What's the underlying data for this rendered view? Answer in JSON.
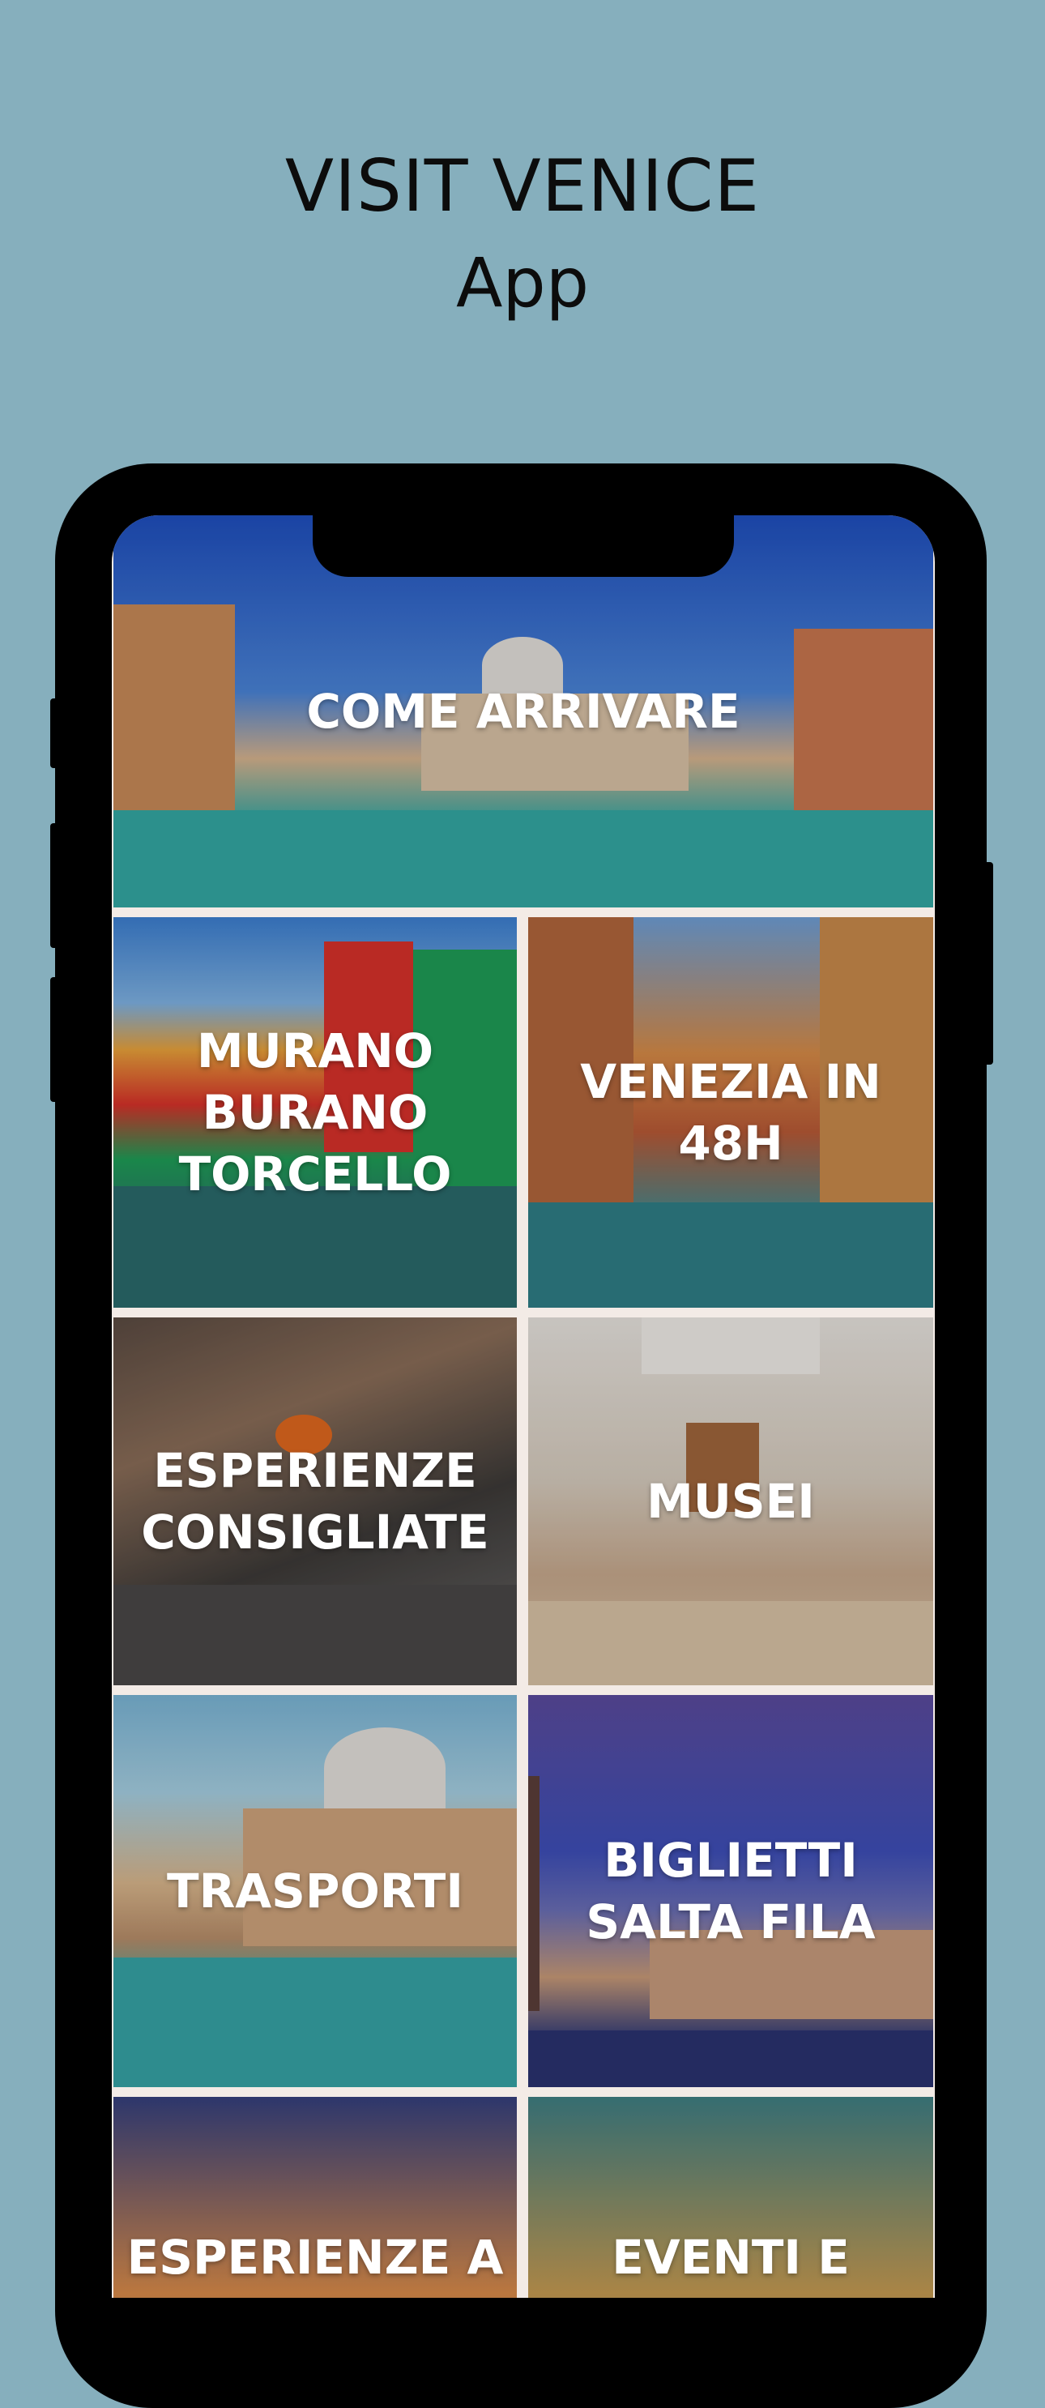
{
  "headline": {
    "line1": "VISIT VENICE",
    "line2": "App"
  },
  "tiles": [
    {
      "id": "come-arrivare",
      "label": "COME ARRIVARE"
    },
    {
      "id": "murano",
      "label": "MURANO\nBURANO\nTORCELLO"
    },
    {
      "id": "venezia-48h",
      "label": "VENEZIA IN\n48H"
    },
    {
      "id": "esperienze",
      "label": "ESPERIENZE\nCONSIGLIATE"
    },
    {
      "id": "musei",
      "label": "MUSEI"
    },
    {
      "id": "trasporti",
      "label": "TRASPORTI"
    },
    {
      "id": "biglietti",
      "label": "BIGLIETTI\nSALTA FILA"
    },
    {
      "id": "esperienze-a",
      "label": "ESPERIENZE A"
    },
    {
      "id": "eventi",
      "label": "EVENTI E"
    }
  ]
}
